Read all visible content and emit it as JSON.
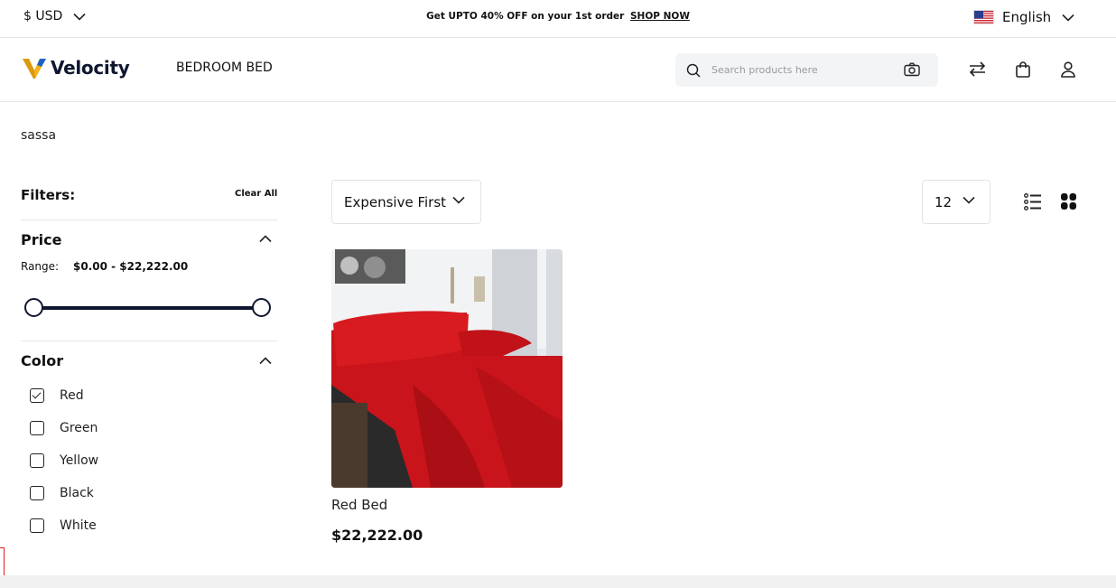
{
  "topbar": {
    "currency": "$ USD",
    "promo_text": "Get UPTO 40% OFF on your 1st order",
    "promo_link": "SHOP NOW",
    "language": "English"
  },
  "header": {
    "logo_text": "Velocity",
    "nav_item": "BEDROOM BED",
    "search_placeholder": "Search products here"
  },
  "search_term": "sassa",
  "filters": {
    "title": "Filters:",
    "clear_all": "Clear All",
    "price": {
      "title": "Price",
      "range_label": "Range:",
      "range_value": "$0.00 - $22,222.00",
      "min": 0,
      "max": 22222
    },
    "color": {
      "title": "Color",
      "options": [
        {
          "label": "Red",
          "checked": true
        },
        {
          "label": "Green",
          "checked": false
        },
        {
          "label": "Yellow",
          "checked": false
        },
        {
          "label": "Black",
          "checked": false
        },
        {
          "label": "White",
          "checked": false
        }
      ]
    }
  },
  "toolbar": {
    "sort": "Expensive First",
    "limit": "12"
  },
  "products": [
    {
      "name": "Red Bed",
      "price": "$22,222.00"
    }
  ],
  "colors": {
    "brand_navy": "#0f1730",
    "logo_gold": "#f5b21b",
    "product_red": "#c8141a"
  }
}
